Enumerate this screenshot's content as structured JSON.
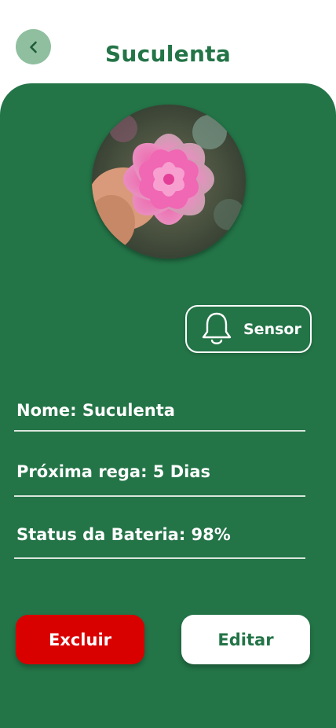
{
  "header": {
    "title": "Suculenta",
    "back_icon": "chevron-left-icon"
  },
  "plant": {
    "photo": "succulent-photo"
  },
  "sensor": {
    "label": "Sensor",
    "icon": "bell-icon"
  },
  "info": {
    "name": "Nome: Suculenta",
    "next_watering": "Próxima rega: 5 Dias",
    "battery_status": "Status da Bateria: 98%"
  },
  "actions": {
    "delete_label": "Excluir",
    "edit_label": "Editar"
  },
  "colors": {
    "primary_green": "#237447",
    "back_button_bg": "#8fbf9f",
    "delete_red": "#d90000",
    "white": "#ffffff"
  }
}
